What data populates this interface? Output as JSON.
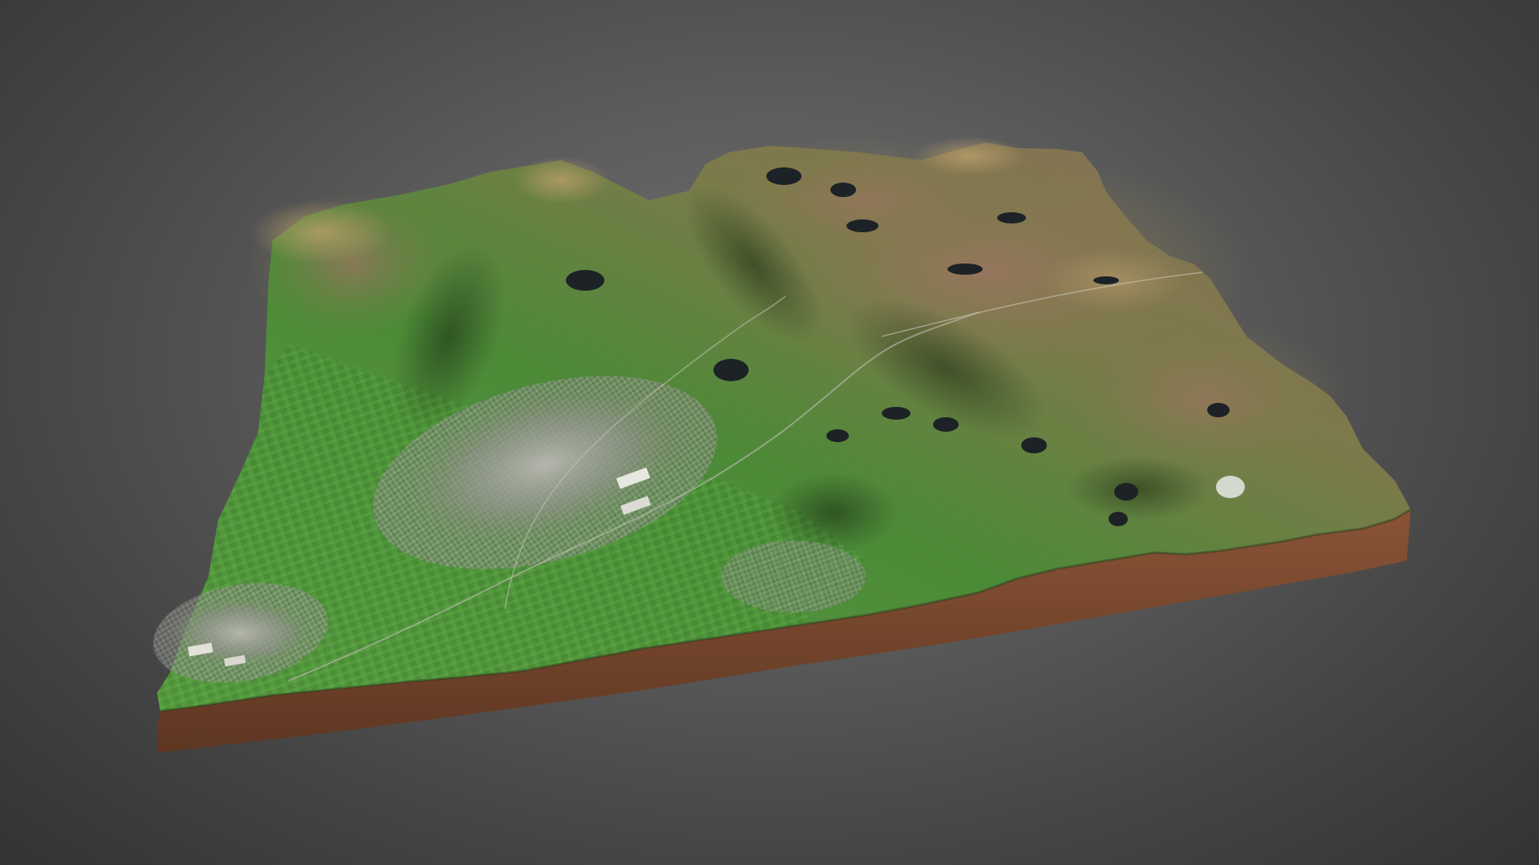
{
  "scene": {
    "background_center": "#6f6f6f",
    "background_edge": "#333333",
    "model": {
      "kind": "3d-terrain-relief-map",
      "surface_texture": "satellite-imagery",
      "colors": {
        "pasture_green": "#4f9a3a",
        "dark_green": "#2f6a2a",
        "moorland_brown": "#8a7a4e",
        "heather_pink": "#a07a6e",
        "urban_gray": "#9a9a92",
        "lake_dark": "#1c2226",
        "base_side": "#7a4a30"
      },
      "features": [
        "hills",
        "valleys",
        "lakes",
        "town",
        "roads",
        "fields"
      ]
    }
  }
}
